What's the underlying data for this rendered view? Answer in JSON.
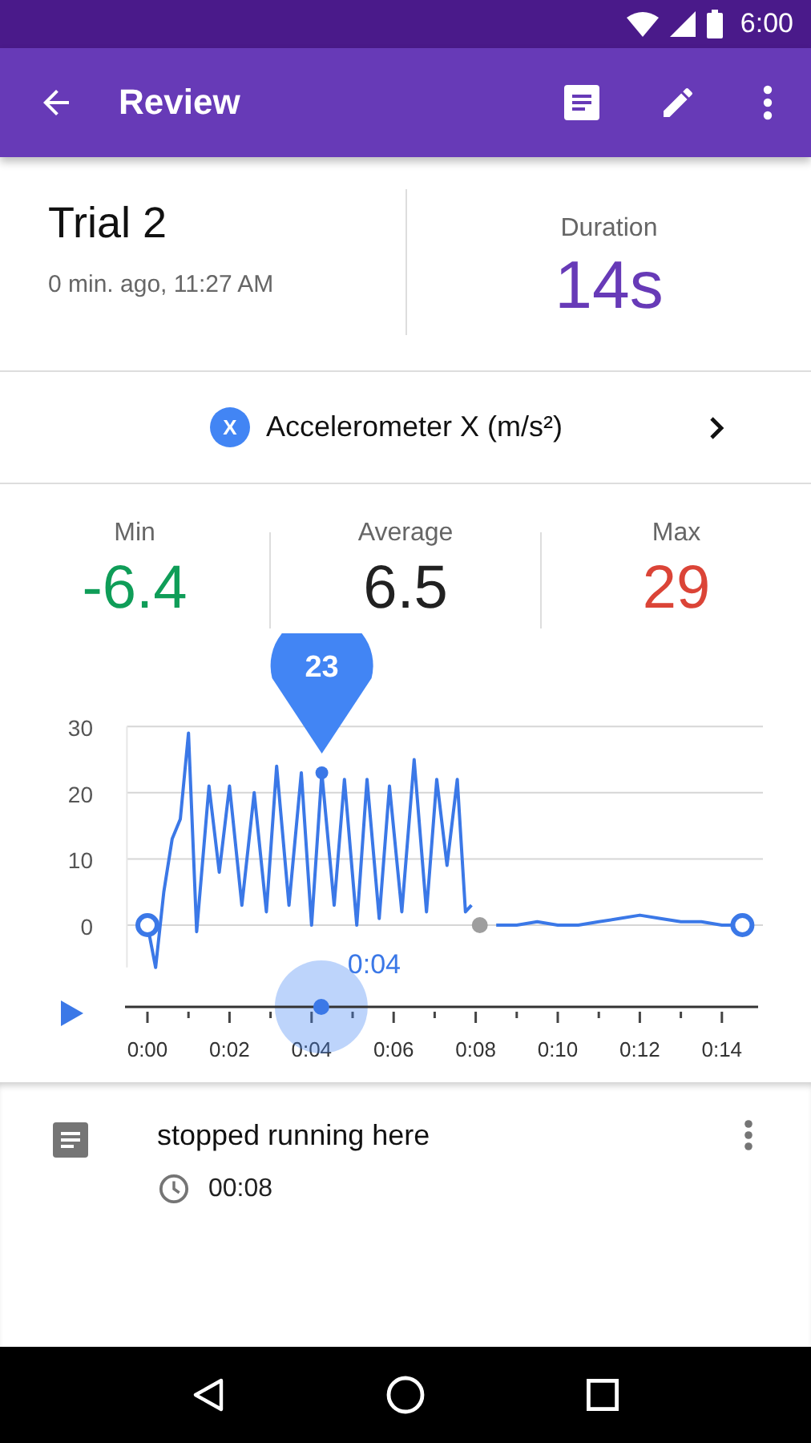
{
  "status_bar": {
    "time": "6:00"
  },
  "toolbar": {
    "title": "Review"
  },
  "trial": {
    "title": "Trial 2",
    "subtitle": "0 min. ago, 11:27 AM",
    "duration_label": "Duration",
    "duration": "14s"
  },
  "sensor": {
    "badge": "X",
    "name": "Accelerometer X (m/s²)"
  },
  "stats": [
    {
      "label": "Min",
      "value": "-6.4",
      "color": "#0f9d58"
    },
    {
      "label": "Average",
      "value": "6.5",
      "color": "#212121"
    },
    {
      "label": "Max",
      "value": "29",
      "color": "#db4437"
    }
  ],
  "chart_data": {
    "type": "line",
    "x": [
      0,
      0.2,
      0.4,
      0.6,
      0.8,
      1.0,
      1.2,
      1.5,
      1.75,
      2.0,
      2.3,
      2.6,
      2.9,
      3.15,
      3.45,
      3.75,
      4.0,
      4.25,
      4.55,
      4.8,
      5.1,
      5.35,
      5.65,
      5.9,
      6.2,
      6.5,
      6.8,
      7.05,
      7.3,
      7.55,
      7.75,
      7.9,
      8.1,
      8.5,
      9.0,
      9.5,
      10.0,
      10.5,
      11.0,
      11.5,
      12.0,
      12.5,
      13.0,
      13.5,
      14.0,
      14.5
    ],
    "series": [
      {
        "color": "#3b78e7",
        "values": [
          0,
          -6.4,
          5,
          13,
          16,
          29,
          -1,
          21,
          8,
          21,
          3,
          20,
          2,
          24,
          3,
          23,
          0,
          23,
          3,
          22,
          0,
          22,
          1,
          21,
          2,
          25,
          2,
          22,
          9,
          22,
          2,
          3,
          null,
          0,
          0,
          0.5,
          0,
          0,
          0.5,
          1,
          1.5,
          1,
          0.5,
          0.5,
          0,
          0
        ]
      }
    ],
    "grid": true,
    "xlim": [
      -0.5,
      15
    ],
    "ylim": [
      -6.4,
      30
    ],
    "yticks": [
      0,
      10,
      20,
      30
    ],
    "xticks": [
      {
        "value": 0,
        "label": "0:00"
      },
      {
        "value": 2,
        "label": "0:02"
      },
      {
        "value": 4,
        "label": "0:04"
      },
      {
        "value": 6,
        "label": "0:06"
      },
      {
        "value": 8,
        "label": "0:08"
      },
      {
        "value": 10,
        "label": "0:10"
      },
      {
        "value": 12,
        "label": "0:12"
      },
      {
        "value": 14,
        "label": "0:14"
      }
    ],
    "annotations": [
      {
        "x": 4.25,
        "y": 23,
        "text": "23"
      }
    ]
  },
  "scrubber": {
    "label": "0:04",
    "level": 0.31
  },
  "note": {
    "text": "stopped running here",
    "time": "00:08"
  }
}
